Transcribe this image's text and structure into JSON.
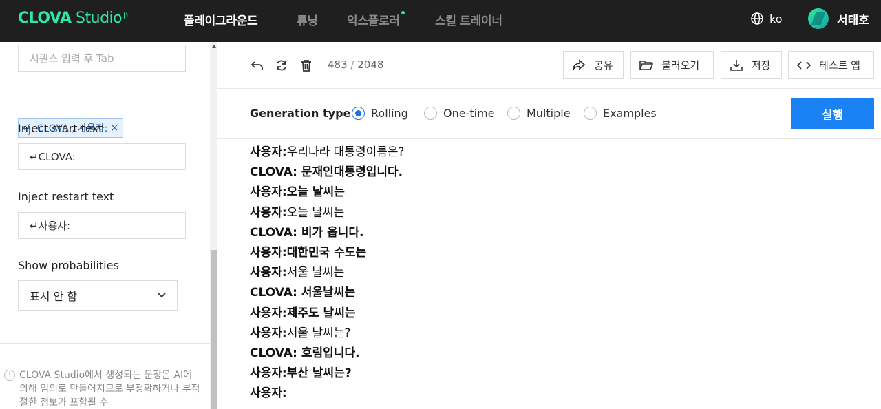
{
  "header": {
    "logo_bold": "CLOVA",
    "logo_light": " Studio",
    "logo_sup": "β",
    "nav": [
      {
        "label": "플레이그라운드",
        "active": true
      },
      {
        "label": "튜닝",
        "active": false
      },
      {
        "label": "익스플로러",
        "active": false
      },
      {
        "label": "스킬 트레이너",
        "active": false
      }
    ],
    "lang": "ko",
    "user": "서태호"
  },
  "sidebar": {
    "stop_sequence_placeholder": "시퀀스 입력 후 Tab",
    "stop_sequence_chip": "↵, CLOVA:, 사용자:",
    "chip_remove": "×",
    "inject_start_label": "Inject start text",
    "inject_start_value": "↵CLOVA:",
    "inject_restart_label": "Inject restart text",
    "inject_restart_value": "↵사용자:",
    "show_prob_label": "Show probabilities",
    "show_prob_value": "표시 안 함",
    "notice_info": "!",
    "notice": "CLOVA Studio에서 생성되는 문장은 AI에 의해 임의로 만들어지므로 부정확하거나 부적절한 정보가 포함될 수"
  },
  "toolbar": {
    "count_current": "483",
    "count_sep": " / ",
    "count_max": "2048",
    "share": "공유",
    "load": "불러오기",
    "save": "저장",
    "test_app": "테스트 앱"
  },
  "generation": {
    "label": "Generation type",
    "options": [
      "Rolling",
      "One-time",
      "Multiple",
      "Examples"
    ],
    "selected": "Rolling",
    "run": "실행"
  },
  "output": {
    "lines": [
      {
        "speaker": "사용자:",
        "text": "우리나라 대통령이름은?",
        "bold": false
      },
      {
        "speaker": "CLOVA:",
        "text": " 문재인대통령입니다.",
        "bold": true
      },
      {
        "speaker": "사용자:",
        "text": "오늘 날씨는",
        "bold": true
      },
      {
        "speaker": "사용자:",
        "text": "오늘 날씨는",
        "bold": false
      },
      {
        "speaker": "CLOVA:",
        "text": " 비가 옵니다.",
        "bold": true
      },
      {
        "speaker": "사용자:",
        "text": "대한민국 수도는",
        "bold": true
      },
      {
        "speaker": "사용자:",
        "text": "서울 날씨는",
        "bold": false
      },
      {
        "speaker": "CLOVA:",
        "text": " 서울날씨는",
        "bold": true
      },
      {
        "speaker": "사용자:",
        "text": "제주도 날씨는",
        "bold": true
      },
      {
        "speaker": "사용자:",
        "text": "서울 날씨는?",
        "bold": false
      },
      {
        "speaker": "CLOVA:",
        "text": " 흐림입니다.",
        "bold": true
      },
      {
        "speaker": "사용자:",
        "text": "부산 날씨는?",
        "bold": true
      },
      {
        "speaker": "사용자:",
        "text": "",
        "bold": true
      }
    ]
  },
  "colors": {
    "brand": "#2ee8a5",
    "primary": "#1a82f5",
    "topbar": "#1f1f1f"
  }
}
